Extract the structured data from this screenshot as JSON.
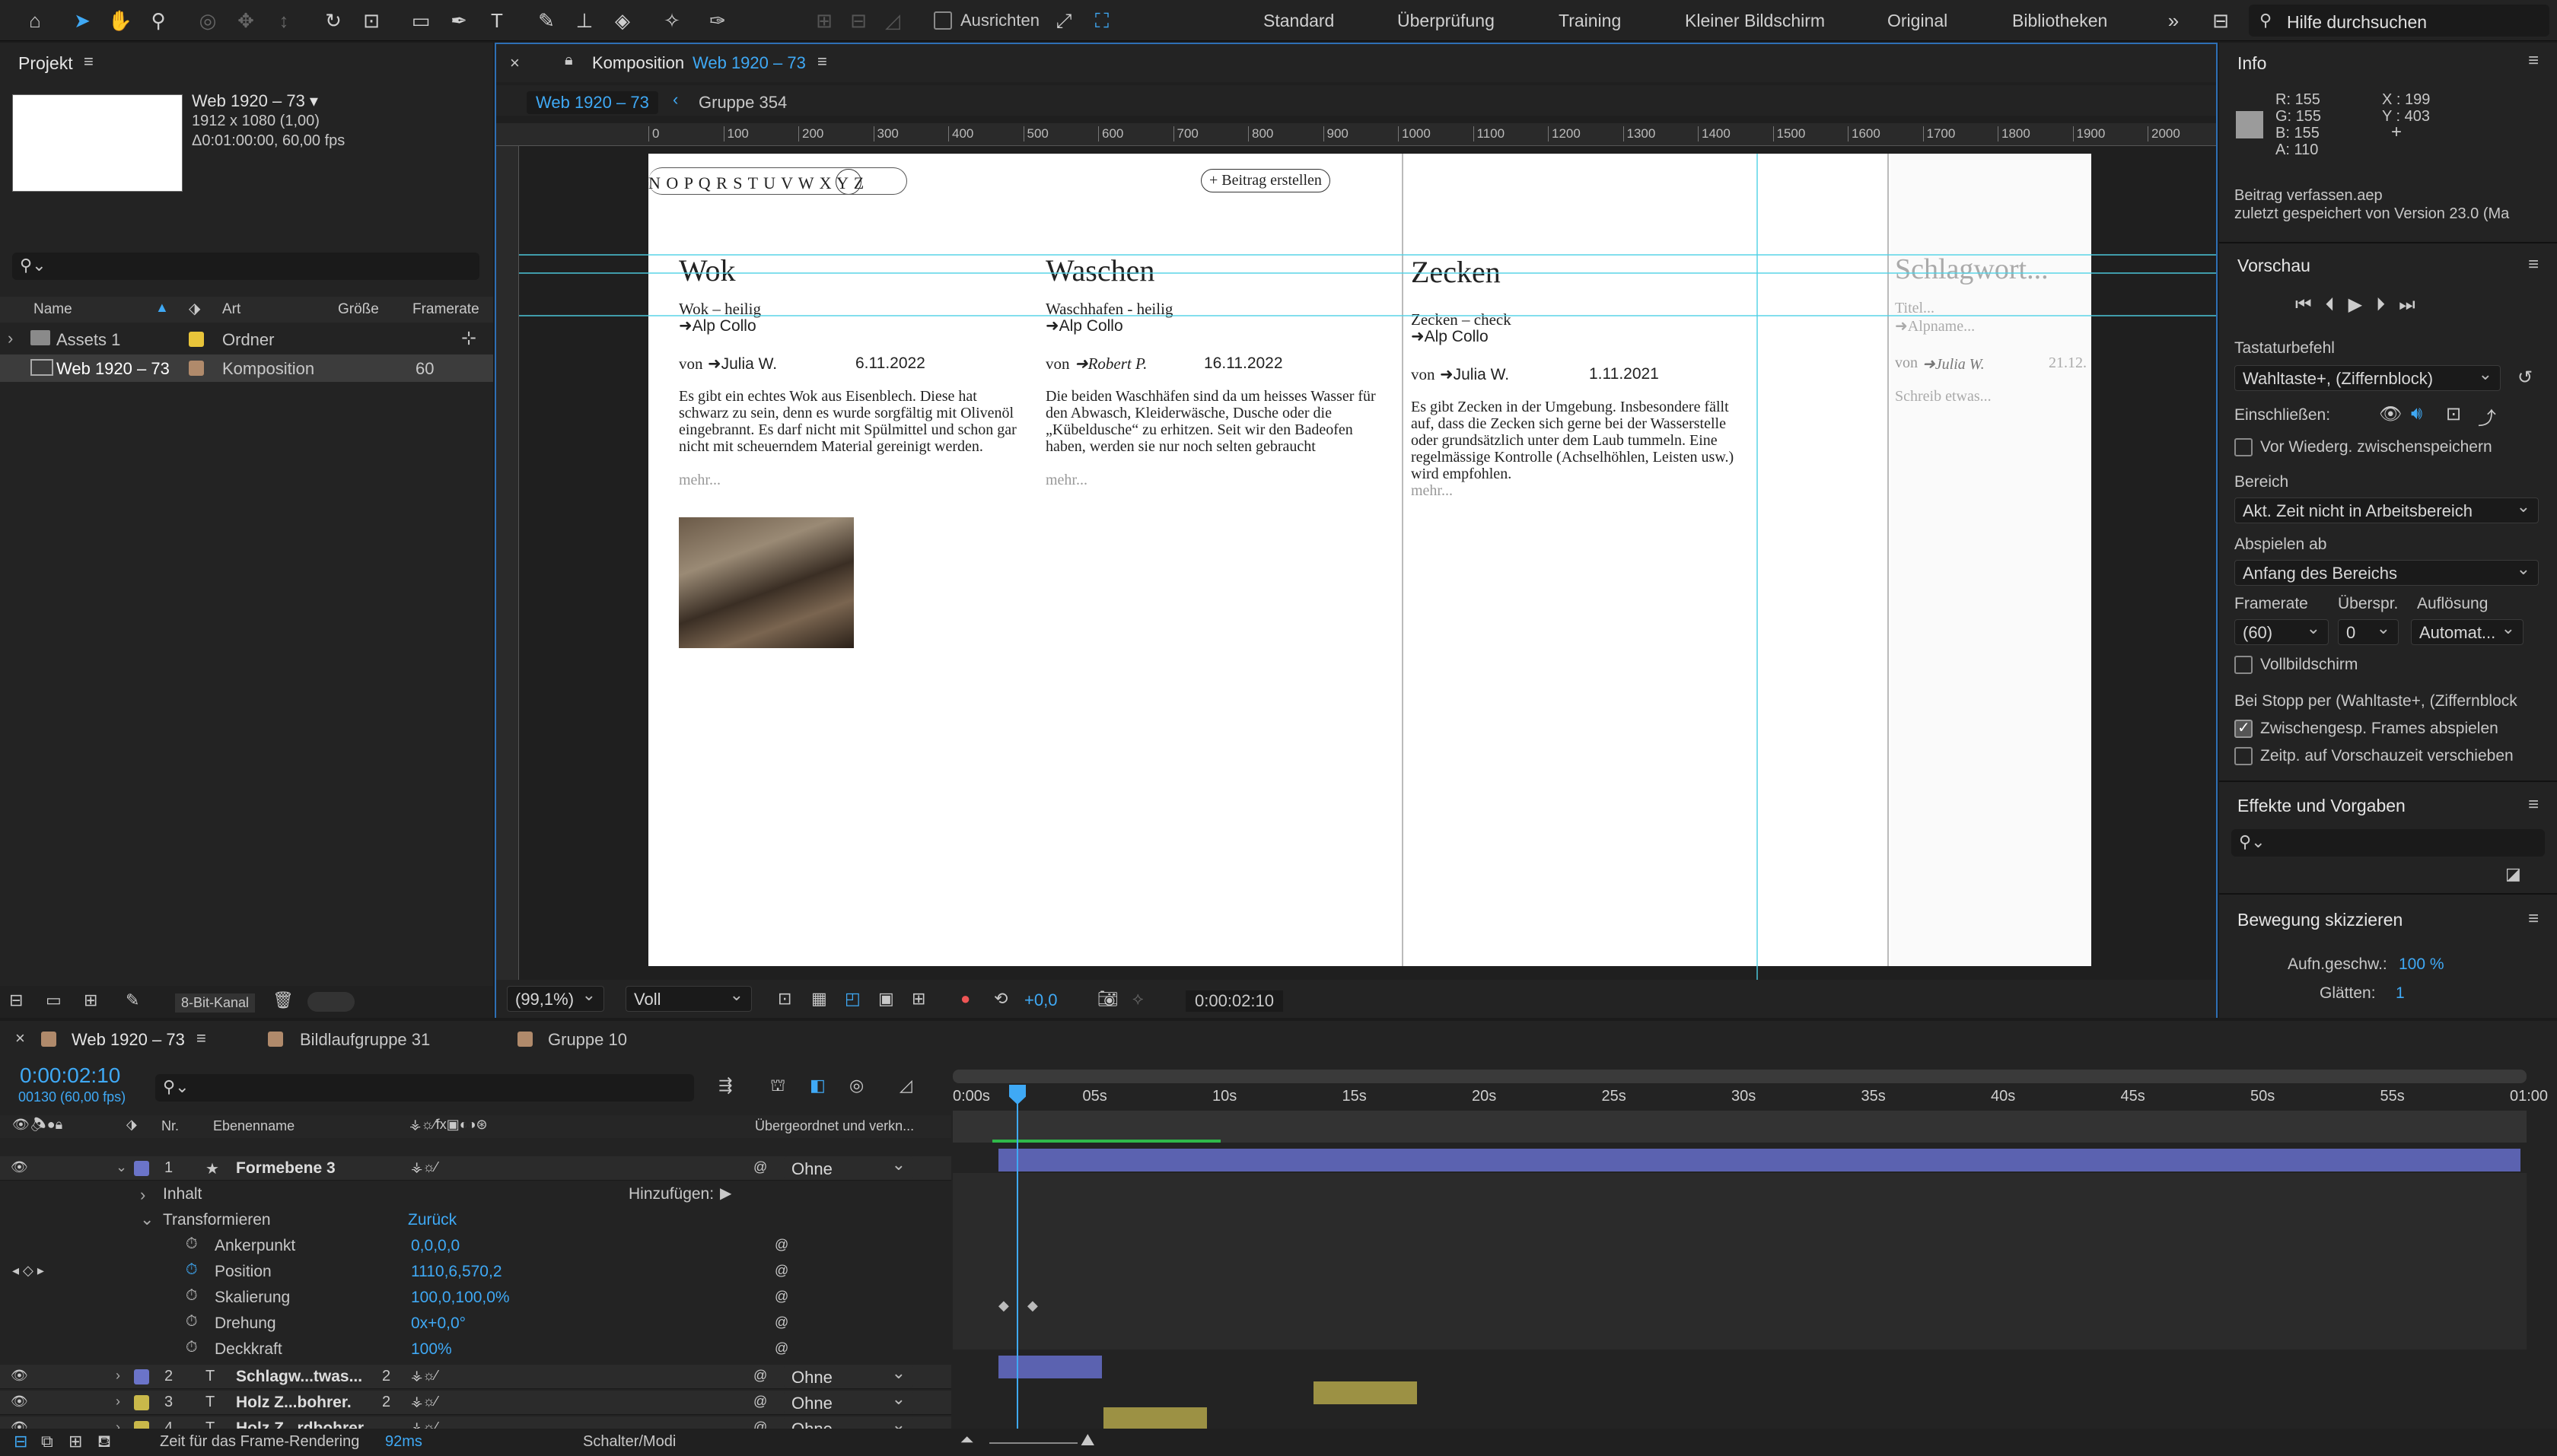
{
  "toolbar": {
    "snap_label": "Ausrichten",
    "workspaces": [
      "Standard",
      "Überprüfung",
      "Training",
      "Kleiner Bildschirm",
      "Original",
      "Bibliotheken"
    ],
    "search_placeholder": "Hilfe durchsuchen"
  },
  "project": {
    "title": "Projekt",
    "item_name": "Web 1920 – 73 ▾",
    "dims": "1912 x 1080 (1,00)",
    "duration": "Δ0:01:00:00, 60,00 fps",
    "columns": [
      "Name",
      "Art",
      "Größe",
      "Framerate"
    ],
    "rows": [
      {
        "name": "Assets 1",
        "type": "Ordner",
        "size": "",
        "fps": ""
      },
      {
        "name": "Web 1920 – 73",
        "type": "Komposition",
        "size": "",
        "fps": "60"
      }
    ],
    "bit_depth": "8-Bit-Kanal"
  },
  "composition": {
    "tab_label": "Komposition",
    "tab_name": "Web 1920 – 73",
    "crumb_active": "Web 1920 – 73",
    "crumb_next": "Gruppe 354",
    "ruler_ticks": [
      "0",
      "100",
      "200",
      "300",
      "400",
      "500",
      "600",
      "700",
      "800",
      "900",
      "1000",
      "1100",
      "1200",
      "1300",
      "1400",
      "1500",
      "1600",
      "1700",
      "1800",
      "1900",
      "2000"
    ],
    "alphabet": "N O P Q R S T U V W X Y Z",
    "alphabet_circled": "W",
    "create_btn": "+ Beitrag erstellen",
    "columns": [
      {
        "title": "Wok",
        "subtitle": "Wok – heilig",
        "location": "➜Alp Collo",
        "author_prefix": "von ",
        "author": "➜Julia W.",
        "date": "6.11.2022",
        "body": "Es gibt ein echtes Wok aus Eisenblech. Diese hat schwarz zu sein, denn es wurde sorgfältig mit Olivenöl eingebrannt. Es darf nicht mit Spülmittel und schon gar nicht mit scheuerndem Material gereinigt werden.",
        "more": "mehr..."
      },
      {
        "title": "Waschen",
        "subtitle": "Waschhafen - heilig",
        "location": "➜Alp Collo",
        "author_prefix": "von ",
        "author": "➜Robert P.",
        "date": "16.11.2022",
        "body": "Die beiden Waschhäfen sind da um heisses Wasser für den Abwasch, Kleiderwäsche, Dusche oder die „Kübeldusche“ zu erhitzen. Seit wir den Badeofen haben, werden sie nur noch selten gebraucht",
        "more": "mehr..."
      },
      {
        "title": "Zecken",
        "subtitle": "Zecken – check",
        "location": "➜Alp Collo",
        "author_prefix": "von ",
        "author": "➜Julia W.",
        "date": "1.11.2021",
        "body": "Es gibt Zecken in der Umgebung. Insbesondere fällt auf, dass die Zecken sich gerne bei der Wasserstelle oder grundsätzlich unter dem Laub tummeln. Eine regelmässige Kontrolle (Achselhöhlen, Leisten usw.) wird empfohlen.",
        "more": "mehr..."
      },
      {
        "title": "Schlagwort...",
        "subtitle": "Titel...",
        "location": "➜Alpname...",
        "author_prefix": "von ",
        "author": "➜Julia W.",
        "date": "21.12.",
        "body": "Schreib etwas...",
        "more": ""
      }
    ],
    "footer": {
      "zoom": "(99,1%)",
      "quality": "Voll",
      "exposure": "+0,0",
      "timecode": "0:00:02:10"
    }
  },
  "info": {
    "title": "Info",
    "r": "155",
    "g": "155",
    "b": "155",
    "a": "110",
    "x": "199",
    "y": "403",
    "file": "Beitrag verfassen.aep",
    "saved": "zuletzt gespeichert von Version 23.0 (Ma"
  },
  "preview": {
    "title": "Vorschau",
    "shortcut_label": "Tastaturbefehl",
    "shortcut_value": "Wahltaste+, (Ziffernblock)",
    "include_label": "Einschließen:",
    "cache_label": "Vor Wiederg. zwischenspeichern",
    "range_label": "Bereich",
    "range_value": "Akt. Zeit nicht in Arbeitsbereich",
    "play_from_label": "Abspielen ab",
    "play_from_value": "Anfang des Bereichs",
    "framerate_label": "Framerate",
    "skip_label": "Überspr.",
    "res_label": "Auflösung",
    "framerate_value": "(60)",
    "skip_value": "0",
    "res_value": "Automat...",
    "fullscreen_label": "Vollbildschirm",
    "stop_label": "Bei Stopp per (Wahltaste+, (Ziffernblock",
    "cached_frames_label": "Zwischengesp. Frames abspielen",
    "shift_time_label": "Zeitp. auf Vorschauzeit verschieben"
  },
  "effects": {
    "title": "Effekte und Vorgaben"
  },
  "motion": {
    "title": "Bewegung skizzieren",
    "speed_label": "Aufn.geschw.:",
    "speed_value": "100 %",
    "smooth_label": "Glätten:",
    "smooth_value": "1"
  },
  "timeline": {
    "tabs": [
      "Web 1920 – 73",
      "Bildlaufgruppe 31",
      "Gruppe 10"
    ],
    "current_time": "0:00:02:10",
    "frame_info": "00130 (60,00 fps)",
    "col_nr": "Nr.",
    "col_name": "Ebenenname",
    "col_parent": "Übergeordnet und verkn...",
    "ruler": [
      "0:00s",
      "05s",
      "10s",
      "15s",
      "20s",
      "25s",
      "30s",
      "35s",
      "40s",
      "45s",
      "50s",
      "55s",
      "01:00"
    ],
    "layers": [
      {
        "nr": "1",
        "name": "Formebene 3",
        "parent": "Ohne",
        "color": "#6b74c9"
      },
      {
        "nr": "2",
        "name": "Schlagw...twas...",
        "parent": "Ohne",
        "color": "#6b74c9"
      },
      {
        "nr": "3",
        "name": "Holz  Z...bohrer.",
        "parent": "Ohne",
        "color": "#c9b84a"
      },
      {
        "nr": "4",
        "name": "Holz  Z...rdbohrer.",
        "parent": "Ohne",
        "color": "#c9b84a"
      }
    ],
    "layer2_num": "2",
    "layer3_num": "2",
    "content_label": "Inhalt",
    "add_label": "Hinzufügen:",
    "transform_label": "Transformieren",
    "reset_label": "Zurück",
    "props": [
      {
        "name": "Ankerpunkt",
        "value": "0,0,0,0"
      },
      {
        "name": "Position",
        "value": "1110,6,570,2"
      },
      {
        "name": "Skalierung",
        "value": "100,0,100,0%"
      },
      {
        "name": "Drehung",
        "value": "0x+0,0°"
      },
      {
        "name": "Deckkraft",
        "value": "100%"
      }
    ],
    "render_label": "Zeit für das Frame-Rendering",
    "render_value": "92ms",
    "switch_label": "Schalter/Modi"
  }
}
